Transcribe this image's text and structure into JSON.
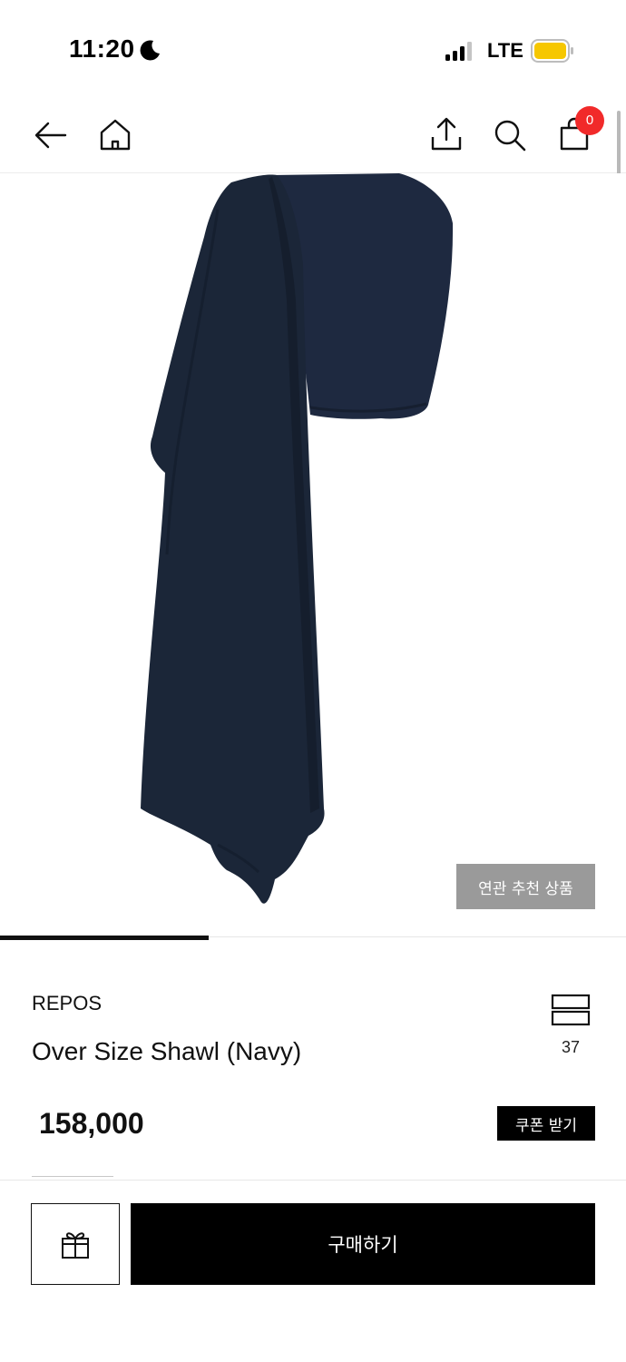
{
  "status_bar": {
    "time": "11:20",
    "carrier": "LTE",
    "moon_icon": "moon-icon",
    "signal_icon": "cellular-signal-icon",
    "battery_icon": "battery-icon",
    "battery_color": "#f6c700"
  },
  "header": {
    "back_icon": "arrow-left-icon",
    "home_icon": "home-icon",
    "share_icon": "share-icon",
    "search_icon": "search-icon",
    "cart_icon": "shopping-bag-icon",
    "cart_count": "0",
    "badge_color": "#f12a2a"
  },
  "gallery": {
    "image": "navy-shawl-photo",
    "related_label": "연관 추천 상품",
    "shawl_color": "#1b2638"
  },
  "product": {
    "brand": "REPOS",
    "name": "Over Size Shawl (Navy)",
    "compare_icon": "stacked-rectangles-icon",
    "compare_count": "37",
    "price": "158,000",
    "coupon_label": "쿠폰 받기"
  },
  "bottom_bar": {
    "gift_icon": "gift-icon",
    "buy_label": "구매하기"
  }
}
